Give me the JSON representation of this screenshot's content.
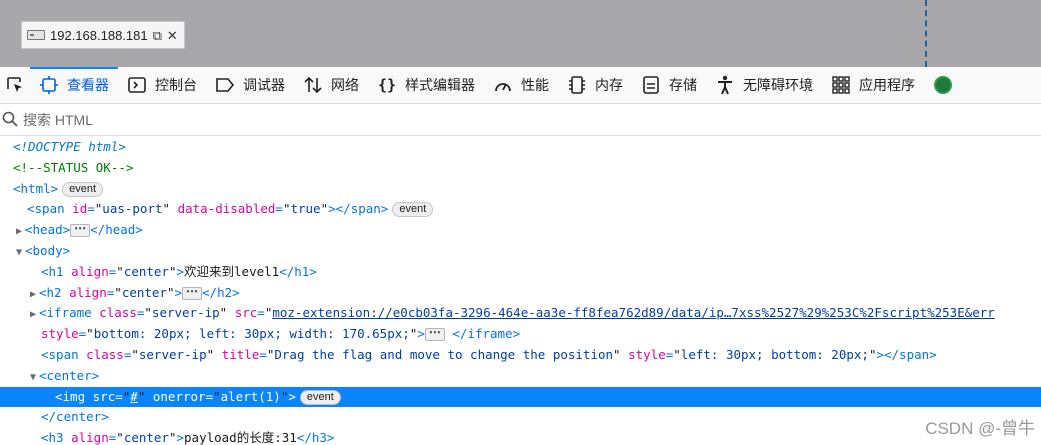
{
  "viewport": {
    "ip_address": "192.168.188.181",
    "copy_icon": "copy-icon",
    "close_icon": "close-icon"
  },
  "toolbar": {
    "picker_icon": "element-picker-icon",
    "tabs": [
      {
        "label": "查看器",
        "icon": "inspector-icon",
        "selected": true
      },
      {
        "label": "控制台",
        "icon": "console-icon"
      },
      {
        "label": "调试器",
        "icon": "debugger-icon"
      },
      {
        "label": "网络",
        "icon": "network-icon"
      },
      {
        "label": "样式编辑器",
        "icon": "style-editor-icon"
      },
      {
        "label": "性能",
        "icon": "performance-icon"
      },
      {
        "label": "内存",
        "icon": "memory-icon"
      },
      {
        "label": "存储",
        "icon": "storage-icon"
      },
      {
        "label": "无障碍环境",
        "icon": "accessibility-icon"
      },
      {
        "label": "应用程序",
        "icon": "application-icon"
      }
    ],
    "accent": "#0a84ff"
  },
  "search": {
    "placeholder": "搜索 HTML"
  },
  "tree": {
    "doctype": "<!DOCTYPE html>",
    "comment": "<!--STATUS OK-->",
    "event_badge": "event",
    "ellipsis": "⋯",
    "span1": {
      "id": "uas-port",
      "data_disabled": "true"
    },
    "h1": {
      "align": "center",
      "text": "欢迎来到level1"
    },
    "h2": {
      "align": "center"
    },
    "iframe": {
      "class": "server-ip",
      "src": "moz-extension://e0cb03fa-3296-464e-aa3e-ff8fea762d89/data/ip…7xss%2527%29%253C%2Fscript%253E&err",
      "style": "bottom: 20px; left: 30px; width: 170.65px;"
    },
    "span2": {
      "class": "server-ip",
      "title": "Drag the flag and move to change the position",
      "style": "left: 30px; bottom: 20px;"
    },
    "img": {
      "src": "#",
      "onerror": "alert(1)"
    },
    "h3": {
      "align": "center",
      "text": "payload的长度:31"
    }
  },
  "watermark": "CSDN @-曾牛"
}
